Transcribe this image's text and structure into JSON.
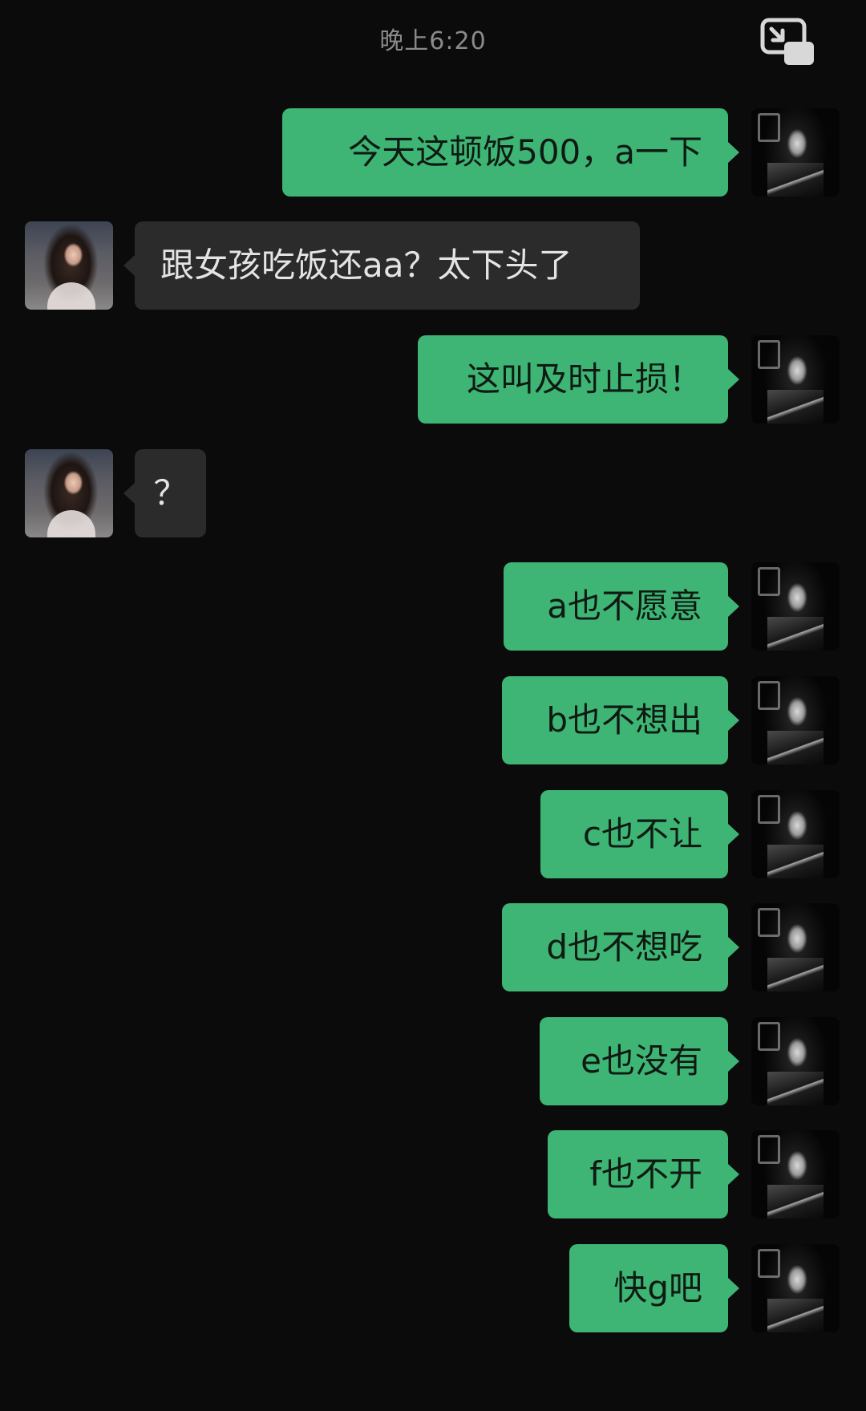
{
  "header": {
    "timestamp": "晚上6:20",
    "pip_icon": "picture-in-picture-icon"
  },
  "messages": [
    {
      "sender": "me",
      "text": "今天这顿饭500，a一下"
    },
    {
      "sender": "her",
      "text": "跟女孩吃饭还aa？太下头了"
    },
    {
      "sender": "me",
      "text": "这叫及时止损！"
    },
    {
      "sender": "her",
      "text": "？"
    },
    {
      "sender": "me",
      "text": "a也不愿意"
    },
    {
      "sender": "me",
      "text": "b也不想出"
    },
    {
      "sender": "me",
      "text": "c也不让"
    },
    {
      "sender": "me",
      "text": "d也不想吃"
    },
    {
      "sender": "me",
      "text": "e也没有"
    },
    {
      "sender": "me",
      "text": "f也不开"
    },
    {
      "sender": "me",
      "text": "快g吧"
    }
  ],
  "colors": {
    "background": "#0b0b0b",
    "sent_bubble": "#3eb575",
    "received_bubble": "#2b2b2b",
    "timestamp_text": "#8a8a8a"
  }
}
